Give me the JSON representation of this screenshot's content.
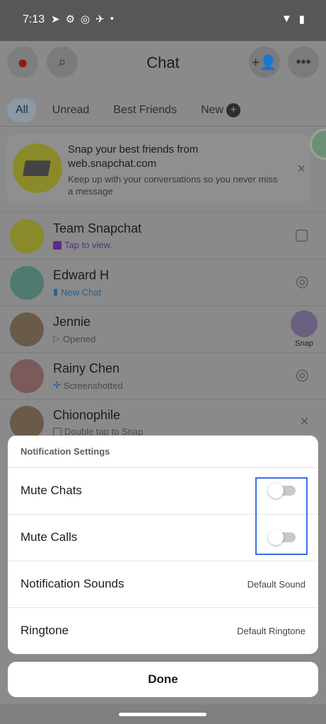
{
  "status_bar": {
    "time": "7:13",
    "dot": "•"
  },
  "header": {
    "title": "Chat"
  },
  "filters": [
    {
      "label": "All",
      "active": true
    },
    {
      "label": "Unread",
      "active": false
    },
    {
      "label": "Best Friends",
      "active": false
    },
    {
      "label": "New",
      "active": false
    }
  ],
  "promo": {
    "title": "Snap your best friends from web.snapchat.com",
    "subtitle": "Keep up with your conversations so you never miss a message",
    "close": "×"
  },
  "chats": [
    {
      "name": "Team Snapchat",
      "status": "Tap to view.",
      "status_color": "#6a3aa0",
      "right": ""
    },
    {
      "name": "Edward H",
      "status": "New Chat",
      "status_color": "#2d6cb0",
      "right": ""
    },
    {
      "name": "Jennie",
      "status": "Opened",
      "status_color": "#4a4a4a",
      "right": "Snap"
    },
    {
      "name": "Rainy Chen",
      "status": "Screenshotted",
      "status_color": "#4a4a4a",
      "right": ""
    },
    {
      "name": "Chionophile",
      "status": "Double tap to Snap",
      "status_color": "#4a4a4a",
      "right": "×"
    }
  ],
  "notification_settings": {
    "title": "Notification Settings",
    "rows": [
      {
        "label": "Mute Chats",
        "type": "toggle",
        "on": false
      },
      {
        "label": "Mute Calls",
        "type": "toggle",
        "on": false
      },
      {
        "label": "Notification Sounds",
        "type": "value",
        "value": "Default Sound"
      },
      {
        "label": "Ringtone",
        "type": "value",
        "value": "Default Ringtone"
      }
    ]
  },
  "done_label": "Done",
  "colors": {
    "highlight": "#3b6ee8",
    "accent_yellow": "#fffc00"
  }
}
